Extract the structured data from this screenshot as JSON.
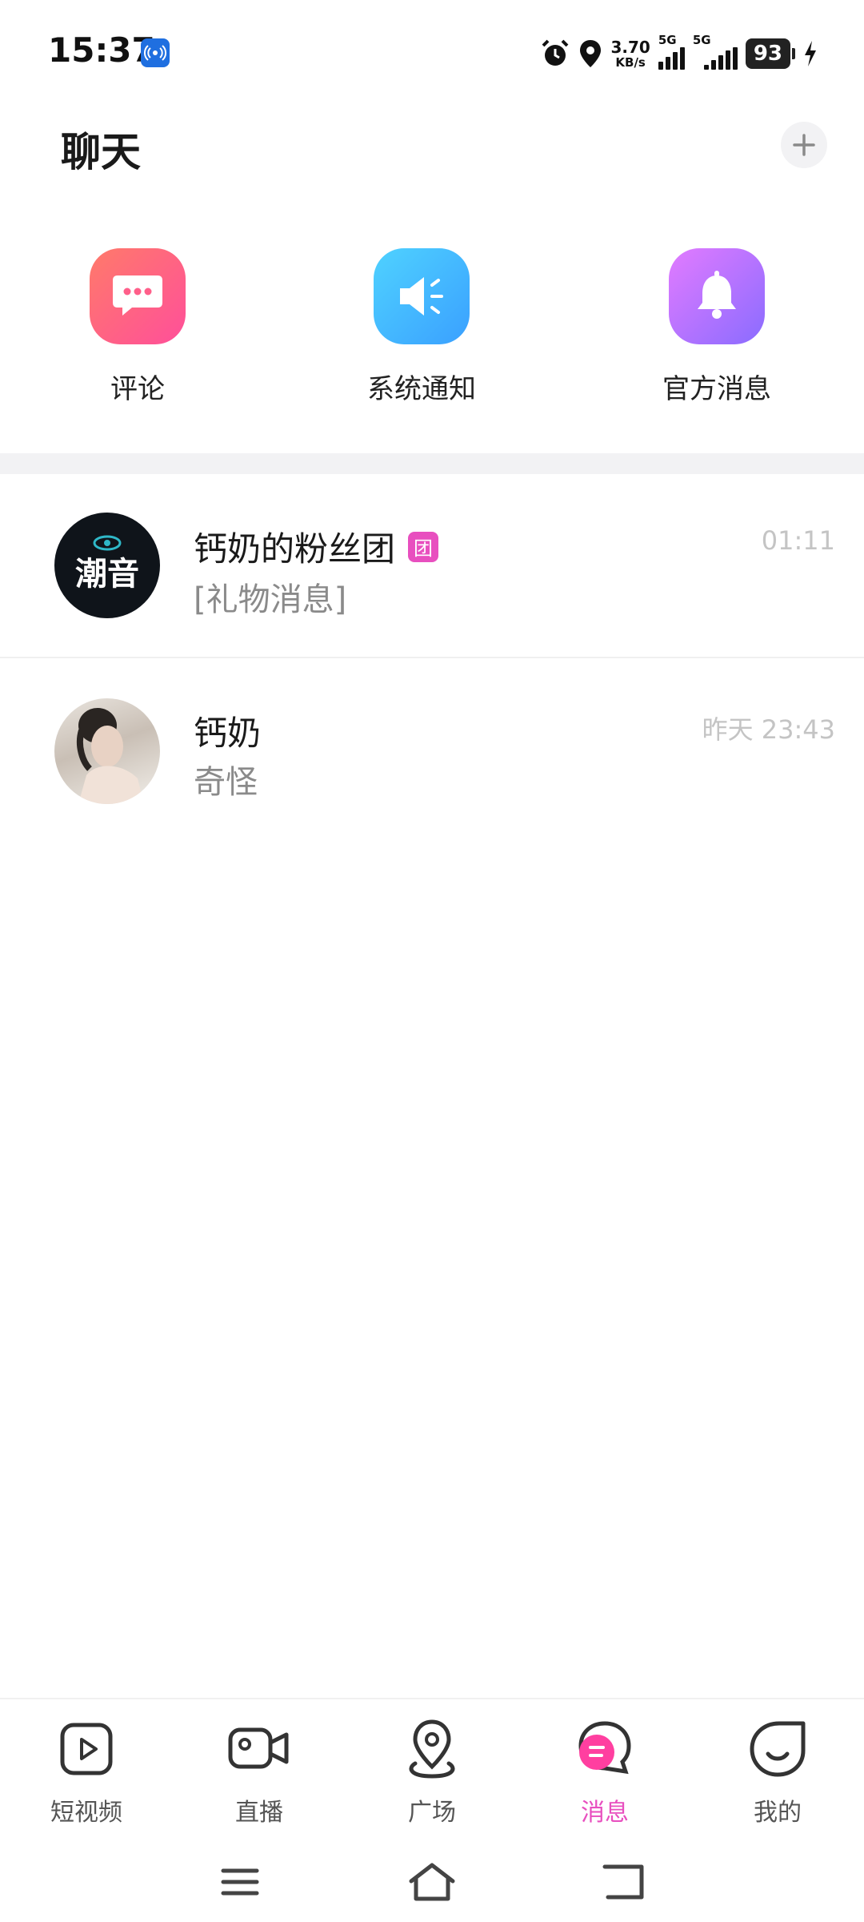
{
  "status_bar": {
    "time": "15:37",
    "net_speed_value": "3.70",
    "net_speed_unit": "KB/s",
    "sim1_label": "5G",
    "sim2_label": "5G",
    "battery": "93"
  },
  "header": {
    "title": "聊天"
  },
  "quick_entries": [
    {
      "label": "评论",
      "icon": "chat-bubble-icon",
      "color": "#ff5f8a"
    },
    {
      "label": "系统通知",
      "icon": "speaker-icon",
      "color": "#45b6ff"
    },
    {
      "label": "官方消息",
      "icon": "bell-icon",
      "color": "#a86cff"
    }
  ],
  "chats": [
    {
      "name": "钙奶的粉丝团",
      "badge": "团",
      "preview": "[礼物消息]",
      "time": "01:11",
      "avatar_text": "潮音"
    },
    {
      "name": "钙奶",
      "preview": "奇怪",
      "time": "昨天 23:43"
    }
  ],
  "tabs": [
    {
      "label": "短视频",
      "icon": "play-square-icon",
      "active": false
    },
    {
      "label": "直播",
      "icon": "video-camera-icon",
      "active": false
    },
    {
      "label": "广场",
      "icon": "location-pin-icon",
      "active": false
    },
    {
      "label": "消息",
      "icon": "message-bubble-icon",
      "active": true
    },
    {
      "label": "我的",
      "icon": "smile-face-icon",
      "active": false
    }
  ],
  "colors": {
    "accent": "#e84fbf",
    "muted_text": "#8a8a8a",
    "time_text": "#c4c4c4"
  }
}
